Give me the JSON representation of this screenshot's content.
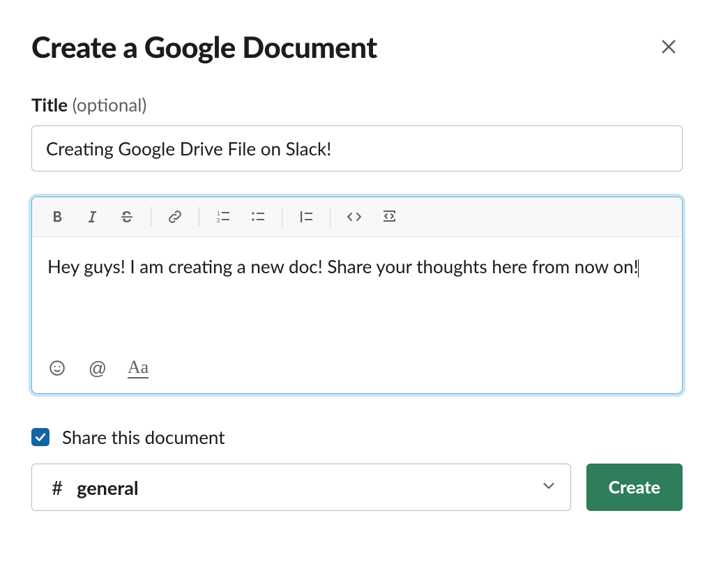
{
  "modal": {
    "title": "Create a Google Document",
    "close_label": "Close"
  },
  "title_field": {
    "label_bold": "Title",
    "label_optional": "(optional)",
    "value": "Creating Google Drive File on Slack!"
  },
  "editor": {
    "toolbar": {
      "bold": "Bold",
      "italic": "Italic",
      "strike": "Strikethrough",
      "link": "Link",
      "ordered": "Ordered list",
      "bullet": "Bulleted list",
      "blockquote": "Blockquote",
      "code": "Code",
      "codeblock": "Code block"
    },
    "body": "Hey guys! I am creating a new doc! Share your thoughts here from now on!",
    "footer": {
      "emoji": "Emoji",
      "mention": "@",
      "format": "Aa"
    }
  },
  "share": {
    "checked": true,
    "label": "Share this document"
  },
  "channel": {
    "prefix": "#",
    "name": "general"
  },
  "actions": {
    "create": "Create"
  }
}
